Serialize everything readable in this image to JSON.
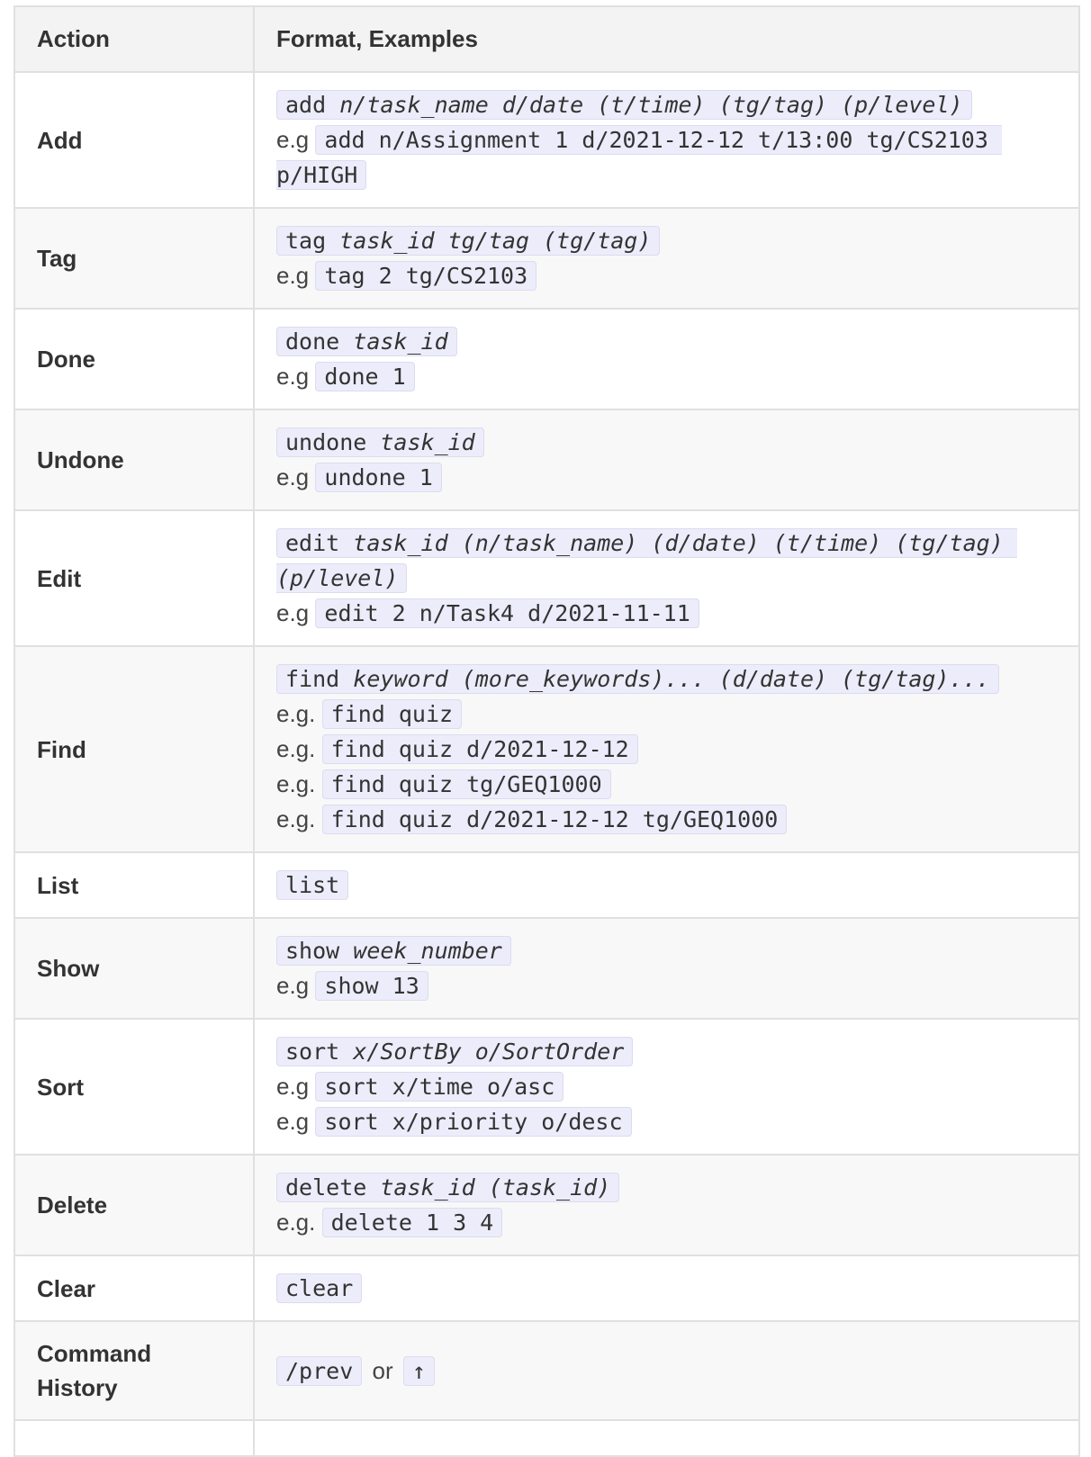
{
  "header": {
    "action": "Action",
    "format": "Format, Examples"
  },
  "rows": {
    "add": {
      "action": "Add",
      "format_cmd": "add",
      "format_args": "n/task_name d/date (t/time) (tg/tag) (p/level)",
      "examples": [
        {
          "prefix": "e.g",
          "code": "add n/Assignment 1 d/2021-12-12 t/13:00 tg/CS2103 p/HIGH"
        }
      ]
    },
    "tag": {
      "action": "Tag",
      "format_cmd": "tag",
      "format_args": "task_id tg/tag (tg/tag)",
      "examples": [
        {
          "prefix": "e.g",
          "code": "tag 2 tg/CS2103"
        }
      ]
    },
    "done": {
      "action": "Done",
      "format_cmd": "done",
      "format_args": "task_id",
      "examples": [
        {
          "prefix": "e.g",
          "code": "done 1"
        }
      ]
    },
    "undone": {
      "action": "Undone",
      "format_cmd": "undone",
      "format_args": "task_id",
      "examples": [
        {
          "prefix": "e.g",
          "code": "undone 1"
        }
      ]
    },
    "edit": {
      "action": "Edit",
      "format_cmd": "edit",
      "format_args": "task_id (n/task_name) (d/date) (t/time) (tg/tag) (p/level)",
      "examples": [
        {
          "prefix": "e.g",
          "code": "edit 2 n/Task4 d/2021-11-11"
        }
      ]
    },
    "find": {
      "action": "Find",
      "format_cmd": "find",
      "format_args": "keyword (more_keywords)... (d/date) (tg/tag)...",
      "examples": [
        {
          "prefix": "e.g.",
          "code": "find quiz"
        },
        {
          "prefix": "e.g.",
          "code": "find quiz d/2021-12-12"
        },
        {
          "prefix": "e.g.",
          "code": "find quiz tg/GEQ1000"
        },
        {
          "prefix": "e.g.",
          "code": "find quiz d/2021-12-12 tg/GEQ1000"
        }
      ]
    },
    "list": {
      "action": "List",
      "format_cmd": "list"
    },
    "show": {
      "action": "Show",
      "format_cmd": "show",
      "format_args": "week_number",
      "examples": [
        {
          "prefix": "e.g",
          "code": "show 13"
        }
      ]
    },
    "sort": {
      "action": "Sort",
      "format_cmd": "sort",
      "format_args": "x/SortBy o/SortOrder",
      "examples": [
        {
          "prefix": "e.g",
          "code": "sort x/time o/asc"
        },
        {
          "prefix": "e.g",
          "code": "sort x/priority o/desc"
        }
      ]
    },
    "delete": {
      "action": "Delete",
      "format_cmd": "delete",
      "format_args": "task_id (task_id)",
      "examples": [
        {
          "prefix": "e.g.",
          "code": "delete 1 3 4"
        }
      ]
    },
    "clear": {
      "action": "Clear",
      "format_cmd": "clear"
    },
    "history": {
      "action_line1": "Command",
      "action_line2": "History",
      "code_prev": "/prev",
      "or_text": "or",
      "code_arrow": "↑"
    }
  }
}
